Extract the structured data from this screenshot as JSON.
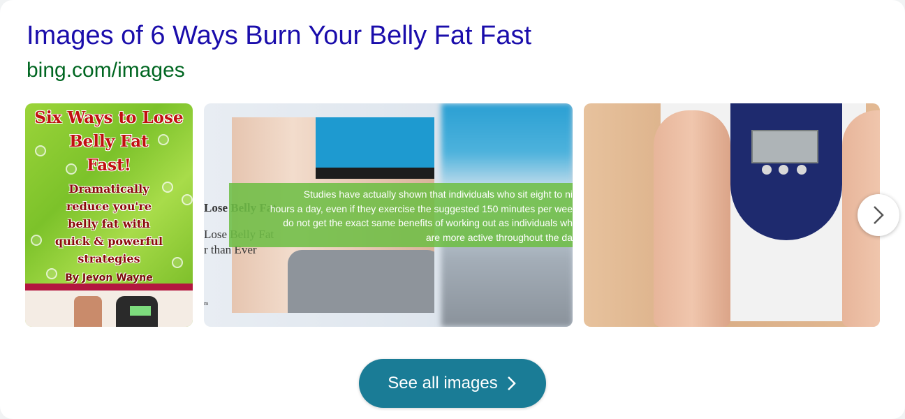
{
  "result": {
    "title": "Images of 6 Ways Burn Your Belly Fat Fast",
    "url": "bing.com/images"
  },
  "thumbnails": [
    {
      "title_lines": [
        "Six Ways to Lose",
        "Belly Fat",
        "Fast!"
      ],
      "sub_lines": [
        "Dramatically",
        "reduce you're",
        "belly fat with",
        "quick & powerful",
        "strategies"
      ],
      "author": "By Jevon Wayne"
    },
    {
      "overlay_lines": [
        "Studies have actually shown that individuals who sit eight to ni",
        "hours a day, even if they exercise the suggested 150 minutes per wee",
        "do not get the exact same benefits of working out as individuals wh",
        "are more active throughout the da"
      ],
      "side_texts": [
        "Lose Belly Fat",
        "Lose Belly Fat",
        "r than Ever",
        "m"
      ]
    },
    {}
  ],
  "see_all_label": "See all images",
  "colors": {
    "title": "#1a0dab",
    "url": "#006621",
    "button": "#1a7c96"
  }
}
